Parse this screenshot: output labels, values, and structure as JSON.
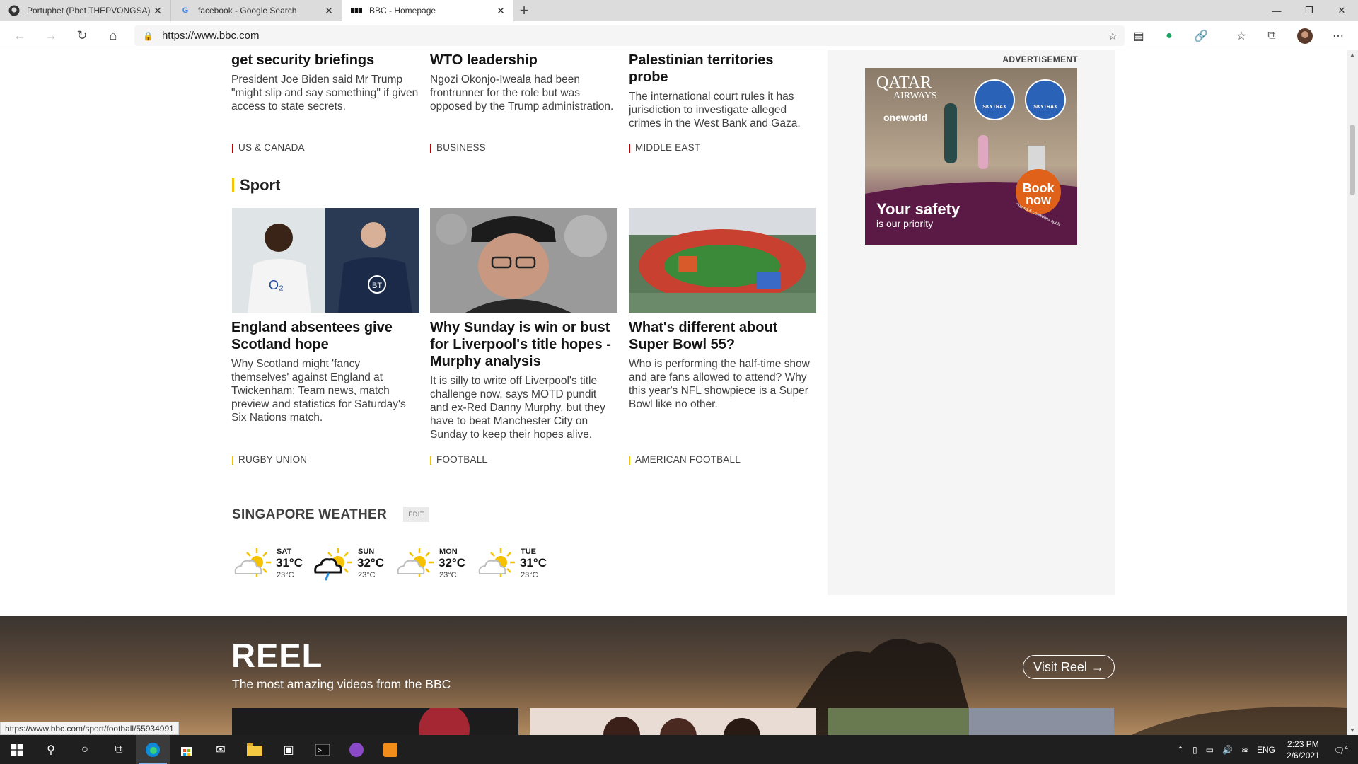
{
  "browser": {
    "tabs": [
      {
        "title": "Portuphet (Phet THEPVONGSA)",
        "icon": "github-icon"
      },
      {
        "title": "facebook - Google Search",
        "icon": "google-icon"
      },
      {
        "title": "BBC - Homepage",
        "icon": "bbc-icon"
      }
    ],
    "url": "https://www.bbc.com",
    "status_url": "https://www.bbc.com/sport/football/55934991"
  },
  "news_row": [
    {
      "headline": "get security briefings",
      "summary": "President Joe Biden said Mr Trump \"might slip and say something\" if given access to state secrets.",
      "tag": "US & CANADA"
    },
    {
      "headline": "WTO leadership",
      "summary": "Ngozi Okonjo-Iweala had been frontrunner for the role but was opposed by the Trump administration.",
      "tag": "BUSINESS"
    },
    {
      "headline": "Palestinian territories probe",
      "summary": "The international court rules it has jurisdiction to investigate alleged crimes in the West Bank and Gaza.",
      "tag": "MIDDLE EAST"
    }
  ],
  "sport": {
    "title": "Sport",
    "articles": [
      {
        "headline": "England absentees give Scotland hope",
        "summary": "Why Scotland might 'fancy themselves' against England at Twickenham: Team news, match preview and statistics for Saturday's Six Nations match.",
        "tag": "RUGBY UNION"
      },
      {
        "headline": "Why Sunday is win or bust for Liverpool's title hopes - Murphy analysis",
        "summary": "It is silly to write off Liverpool's title challenge now, says MOTD pundit and ex-Red Danny Murphy, but they have to beat Manchester City on Sunday to keep their hopes alive.",
        "tag": "FOOTBALL"
      },
      {
        "headline": "What's different about Super Bowl 55?",
        "summary": "Who is performing the half-time show and are fans allowed to attend? Why this year's NFL showpiece is a Super Bowl like no other.",
        "tag": "AMERICAN FOOTBALL"
      }
    ]
  },
  "ad": {
    "label": "ADVERTISEMENT",
    "brand_line1": "QATAR",
    "brand_line2": "AIRWAYS",
    "alliance": "oneworld",
    "headline": "Your safety",
    "subline": "is our priority",
    "cta_line1": "Book",
    "cta_line2": "now",
    "terms": "*Terms & conditions apply",
    "badge": "SKYTRAX"
  },
  "weather": {
    "title": "SINGAPORE WEATHER",
    "edit_label": "EDIT",
    "days": [
      {
        "day": "SAT",
        "high": "31°C",
        "low": "23°C",
        "icon": "sun-cloud-icon"
      },
      {
        "day": "SUN",
        "high": "32°C",
        "low": "23°C",
        "icon": "sun-rain-cloud-icon"
      },
      {
        "day": "MON",
        "high": "32°C",
        "low": "23°C",
        "icon": "sun-cloud-icon"
      },
      {
        "day": "TUE",
        "high": "31°C",
        "low": "23°C",
        "icon": "sun-cloud-icon"
      }
    ]
  },
  "reel": {
    "title": "REEL",
    "subtitle": "The most amazing videos from the BBC",
    "button": "Visit Reel"
  },
  "taskbar": {
    "lang": "ENG",
    "time": "2:23 PM",
    "date": "2/6/2021",
    "notifications": "4"
  },
  "colors": {
    "news_tag": "#b80000",
    "sport_tag": "#f5c100",
    "ad_purple": "#5a1a45"
  }
}
